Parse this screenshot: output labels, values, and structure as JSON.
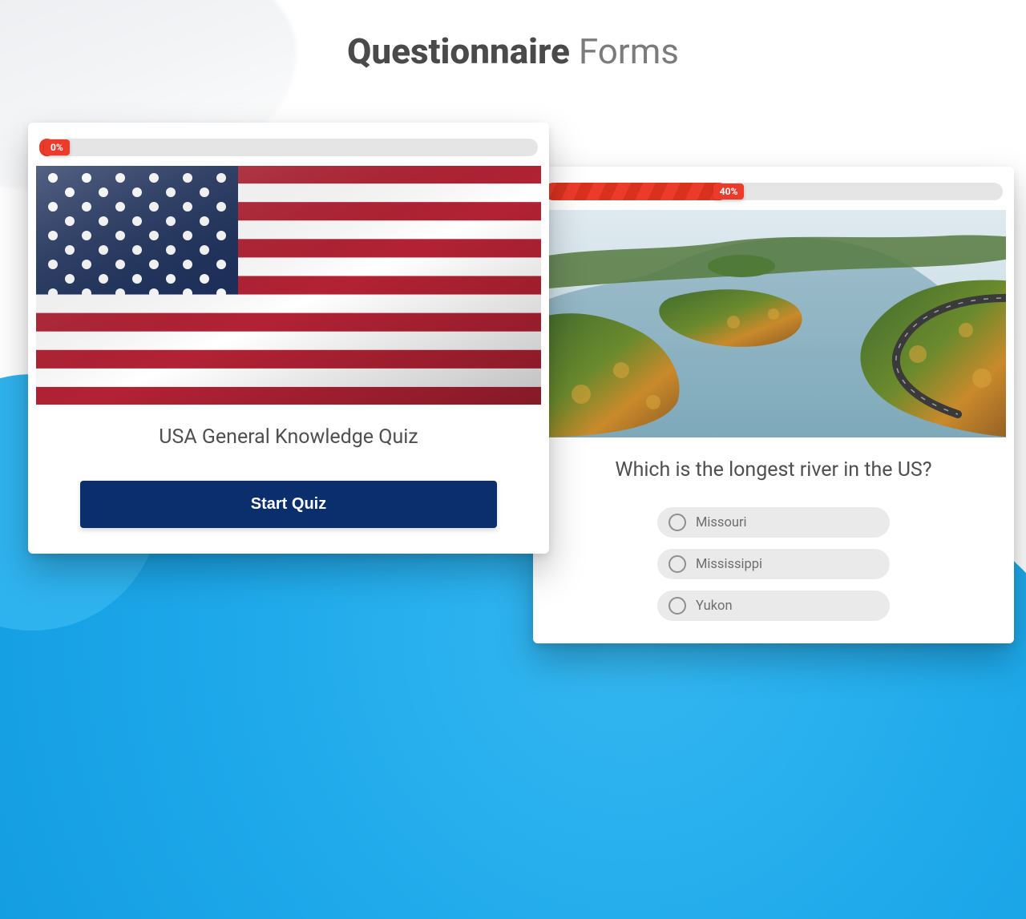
{
  "title_bold": "Questionnaire",
  "title_light": "Forms",
  "cards": {
    "left": {
      "progress_percent": 0,
      "progress_label": "0%",
      "heading": "USA General Knowledge Quiz",
      "button_label": "Start Quiz"
    },
    "right": {
      "progress_percent": 40,
      "progress_label": "40%",
      "question": "Which is the longest river in the US?",
      "options": [
        "Missouri",
        "Mississippi",
        "Yukon"
      ]
    }
  },
  "colors": {
    "accent_red": "#ed3b2b",
    "primary_dark_blue": "#0b2f6c",
    "bg_cyan": "#1da8ea"
  }
}
